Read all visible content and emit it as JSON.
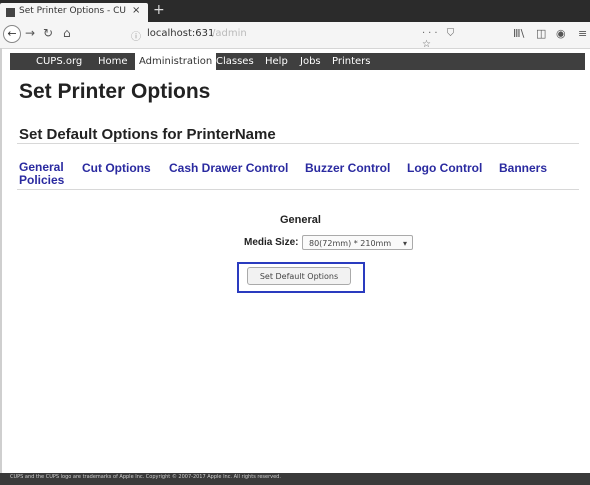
{
  "browser": {
    "tab_title": "Set Printer Options - CU",
    "close_glyph": "×",
    "new_tab_glyph": "+",
    "url_host": "localhost:631",
    "url_path": "/admin",
    "url_right_icons": "··· ⛉ ☆"
  },
  "cups_nav": {
    "items": [
      "CUPS.org",
      "Home",
      "Administration",
      "Classes",
      "Help",
      "Jobs",
      "Printers"
    ],
    "active": "Administration"
  },
  "page": {
    "title": "Set Printer Options",
    "subtitle": "Set Default Options for PrinterName",
    "tabs": [
      {
        "label": "General Policies"
      },
      {
        "label": "Cut Options"
      },
      {
        "label": "Cash Drawer Control"
      },
      {
        "label": "Buzzer Control"
      },
      {
        "label": "Logo Control"
      },
      {
        "label": "Banners"
      }
    ]
  },
  "form": {
    "section": "General",
    "media_label": "Media Size:",
    "media_value": "80(72mm) * 210mm",
    "submit_label": "Set Default Options"
  },
  "footer": {
    "text": "CUPS and the CUPS logo are trademarks of Apple Inc. Copyright © 2007-2017 Apple Inc. All rights reserved."
  },
  "colors": {
    "link": "#2a2aa0",
    "highlight": "#2a3bbf",
    "nav_bg": "#3f3f3f"
  }
}
